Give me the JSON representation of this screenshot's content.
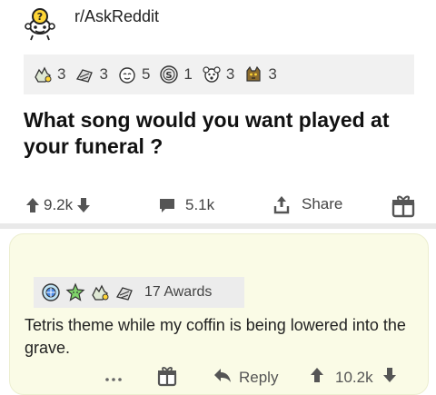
{
  "post": {
    "subreddit": "r/AskReddit",
    "awards": [
      {
        "icon": "helpful-hand-award-icon",
        "count": "3"
      },
      {
        "icon": "hand-drawn-award-icon",
        "count": "3"
      },
      {
        "icon": "wholesome-face-award-icon",
        "count": "5"
      },
      {
        "icon": "silver-coin-award-icon",
        "count": "1"
      },
      {
        "icon": "gift-bear-award-icon",
        "count": "3"
      },
      {
        "icon": "gold-cat-award-icon",
        "count": "3"
      }
    ],
    "title": "What song would you want played at your funeral ?",
    "score": "9.2k",
    "comments": "5.1k",
    "share_label": "Share"
  },
  "comment": {
    "awards_label": "17 Awards",
    "text": "Tetris theme while my coffin is being lowered into the grave.",
    "reply_label": "Reply",
    "score": "10.2k"
  },
  "colors": {
    "accent_blue": "#4a8be8",
    "comment_bg": "#fafbe6",
    "icon_gray": "#555555"
  }
}
